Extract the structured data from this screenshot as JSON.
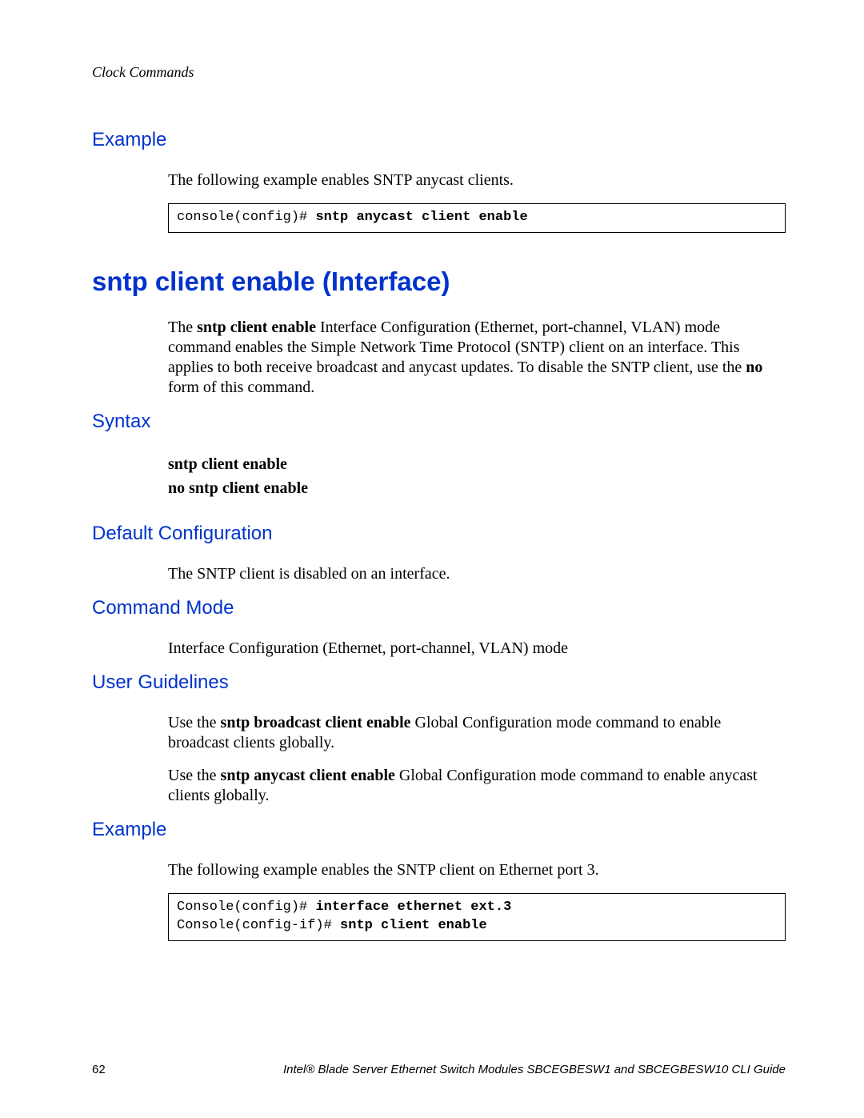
{
  "header": {
    "section": "Clock Commands"
  },
  "sections": {
    "example_top": {
      "heading": "Example",
      "para": "The following example enables SNTP anycast clients.",
      "code_prompt": "console(config)# ",
      "code_cmd": "sntp anycast client enable"
    },
    "main_title": "sntp client enable (Interface)",
    "intro": {
      "pre": "The ",
      "bold1": "sntp client enable",
      "mid": " Interface Configuration (Ethernet, port-channel, VLAN) mode command enables the Simple Network Time Protocol (SNTP) client on an interface. This applies to both receive broadcast and anycast updates. To disable the SNTP client, use the ",
      "bold2": "no",
      "post": " form of this command."
    },
    "syntax": {
      "heading": "Syntax",
      "line1": "sntp client enable",
      "line2": "no sntp client enable"
    },
    "default_cfg": {
      "heading": "Default Configuration",
      "para": "The SNTP client is disabled on an interface."
    },
    "cmd_mode": {
      "heading": "Command Mode",
      "para": "Interface Configuration (Ethernet, port-channel, VLAN) mode"
    },
    "guidelines": {
      "heading": "User Guidelines",
      "p1_pre": "Use the ",
      "p1_bold": "sntp broadcast client enable",
      "p1_post": " Global Configuration mode command to enable broadcast clients globally.",
      "p2_pre": "Use the ",
      "p2_bold": "sntp anycast client enable",
      "p2_post": " Global Configuration mode command to enable anycast clients globally."
    },
    "example_bottom": {
      "heading": "Example",
      "para": "The following example enables the SNTP client on Ethernet port 3.",
      "code_prompt1": "Console(config)# ",
      "code_cmd1": "interface ethernet ext.3",
      "code_prompt2": "Console(config-if)# ",
      "code_cmd2": "sntp client enable"
    }
  },
  "footer": {
    "page": "62",
    "doc": "Intel® Blade Server Ethernet Switch Modules SBCEGBESW1 and SBCEGBESW10 CLI Guide"
  }
}
